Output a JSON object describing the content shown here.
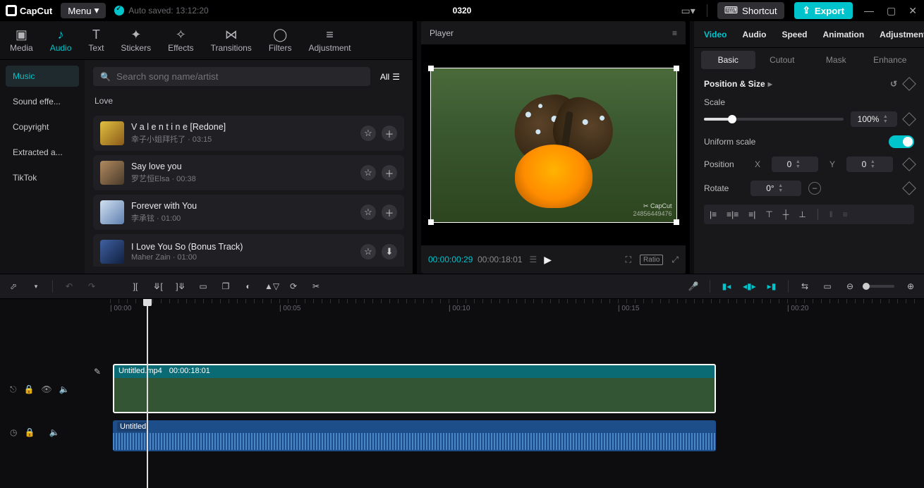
{
  "app": {
    "brand": "CapCut",
    "menu": "Menu",
    "autosave": "Auto saved: 13:12:20",
    "projectTitle": "0320",
    "shortcut": "Shortcut",
    "export": "Export"
  },
  "topTabs": [
    {
      "id": "media",
      "label": "Media"
    },
    {
      "id": "audio",
      "label": "Audio"
    },
    {
      "id": "text",
      "label": "Text"
    },
    {
      "id": "stickers",
      "label": "Stickers"
    },
    {
      "id": "effects",
      "label": "Effects"
    },
    {
      "id": "transitions",
      "label": "Transitions"
    },
    {
      "id": "filters",
      "label": "Filters"
    },
    {
      "id": "adjustment",
      "label": "Adjustment"
    }
  ],
  "sidebar": {
    "items": [
      {
        "label": "Music",
        "active": true
      },
      {
        "label": "Sound effe..."
      },
      {
        "label": "Copyright"
      },
      {
        "label": "Extracted a..."
      },
      {
        "label": "TikTok"
      }
    ]
  },
  "search": {
    "placeholder": "Search song name/artist",
    "all": "All"
  },
  "category": "Love",
  "songs": [
    {
      "title": "V a l e n t i n e  [Redone]",
      "artist": "幸子小姐拜托了",
      "dur": "03:15",
      "thumb": "g1",
      "dl": false
    },
    {
      "title": "Say love you",
      "artist": "罗艺恒Elsa",
      "dur": "00:38",
      "thumb": "g2",
      "dl": false
    },
    {
      "title": "Forever with You",
      "artist": "李承铉",
      "dur": "01:00",
      "thumb": "g3",
      "dl": false
    },
    {
      "title": "I Love You So (Bonus Track)",
      "artist": "Maher Zain",
      "dur": "01:00",
      "thumb": "g4",
      "dl": true
    }
  ],
  "player": {
    "title": "Player",
    "curTime": "00:00:00:29",
    "totalTime": "00:00:18:01",
    "ratio": "Ratio",
    "watermarkBrand": "CapCut",
    "watermarkId": "24856449476"
  },
  "inspector": {
    "tabs": [
      "Video",
      "Audio",
      "Speed",
      "Animation",
      "Adjustment"
    ],
    "subtabs": [
      "Basic",
      "Cutout",
      "Mask",
      "Enhance"
    ],
    "section": "Position & Size",
    "scaleLabel": "Scale",
    "scaleValue": "100%",
    "uniformLabel": "Uniform scale",
    "positionLabel": "Position",
    "posX": "0",
    "posY": "0",
    "axisX": "X",
    "axisY": "Y",
    "rotateLabel": "Rotate",
    "rotateValue": "0°"
  },
  "timeline": {
    "ticks": [
      "00:00",
      "00:05",
      "00:10",
      "00:15",
      "00:20"
    ],
    "clip": {
      "name": "Untitled.mp4",
      "dur": "00:00:18:01"
    },
    "audioClip": {
      "name": "Untitled"
    }
  }
}
